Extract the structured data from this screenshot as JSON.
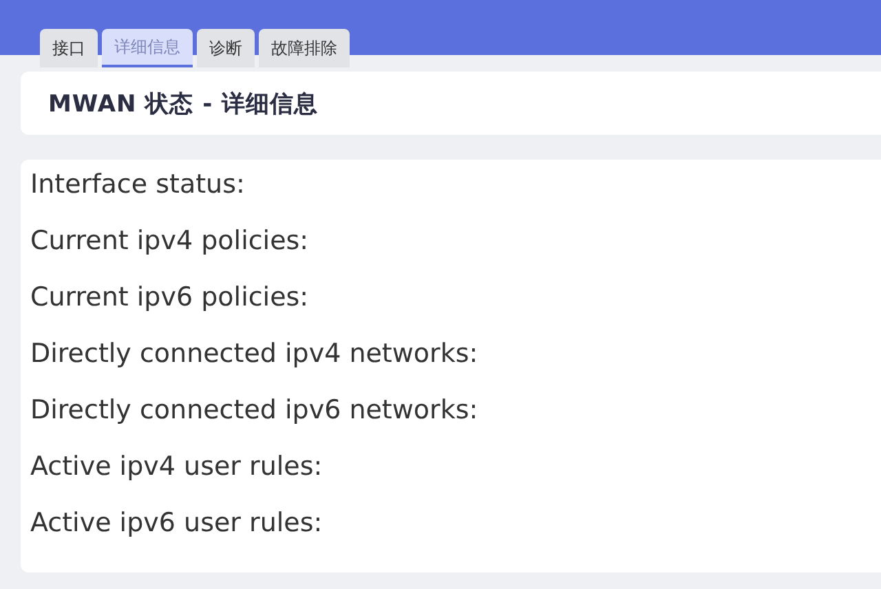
{
  "tabs": [
    {
      "label": "接口",
      "selected": false
    },
    {
      "label": "详细信息",
      "selected": true
    },
    {
      "label": "诊断",
      "selected": false
    },
    {
      "label": "故障排除",
      "selected": false
    }
  ],
  "title": "MWAN 状态 - 详细信息",
  "details": [
    "Interface status:",
    "Current ipv4 policies:",
    "Current ipv6 policies:",
    "Directly connected ipv4 networks:",
    "Directly connected ipv6 networks:",
    "Active ipv4 user rules:",
    "Active ipv6 user rules:"
  ]
}
